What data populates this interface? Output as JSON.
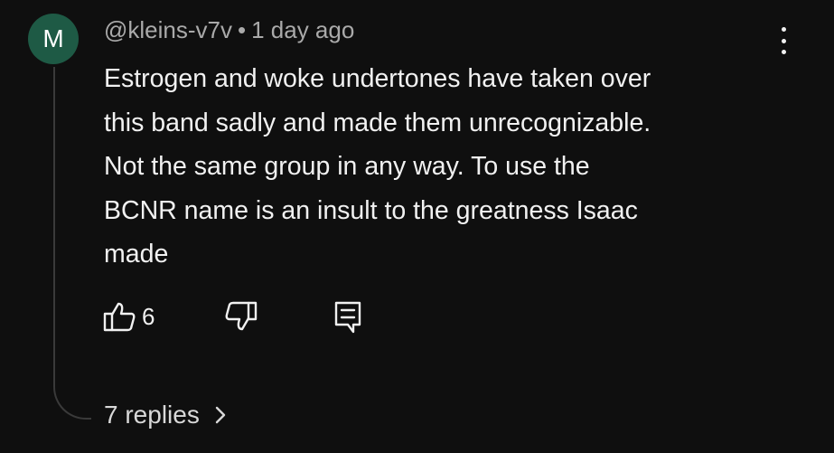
{
  "author": {
    "avatar_letter": "M",
    "avatar_color": "#1e5a45",
    "handle": "@kleins-v7v",
    "separator": "•",
    "time": "1 day ago"
  },
  "comment": {
    "lines": [
      "Estrogen and woke undertones have taken over",
      "this band sadly and made them unrecognizable.",
      "Not the same group in any way. To use the",
      "BCNR name is an insult to the greatness Isaac",
      "made"
    ]
  },
  "actions": {
    "like_icon": "thumbs-up-icon",
    "like_count": "6",
    "dislike_icon": "thumbs-down-icon",
    "reply_icon": "reply-comment-icon",
    "more_icon": "more-vertical-icon"
  },
  "replies": {
    "label": "7 replies",
    "icon": "chevron-right-icon"
  }
}
